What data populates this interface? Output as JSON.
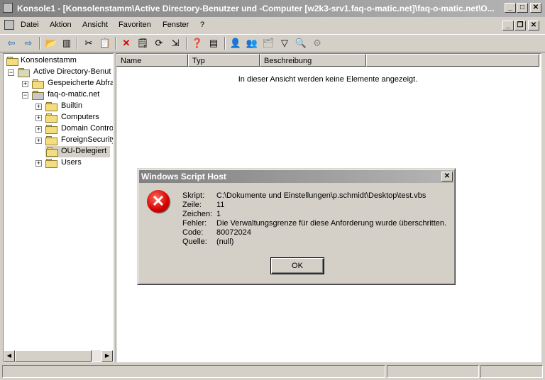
{
  "window": {
    "title": "Konsole1 - [Konsolenstamm\\Active Directory-Benutzer und -Computer [w2k3-srv1.faq-o-matic.net]\\faq-o-matic.net\\O..."
  },
  "menu": {
    "items": [
      "Datei",
      "Aktion",
      "Ansicht",
      "Favoriten",
      "Fenster",
      "?"
    ]
  },
  "tree": {
    "root": "Konsolenstamm",
    "items": [
      {
        "label": "Active Directory-Benut",
        "expander": "−"
      },
      {
        "label": "Gespeicherte Abfra",
        "expander": "+"
      },
      {
        "label": "faq-o-matic.net",
        "expander": "−"
      },
      {
        "label": "Builtin",
        "expander": "+"
      },
      {
        "label": "Computers",
        "expander": "+"
      },
      {
        "label": "Domain Contro",
        "expander": "+"
      },
      {
        "label": "ForeignSecurity",
        "expander": "+"
      },
      {
        "label": "OU-Delegiert",
        "expander": ""
      },
      {
        "label": "Users",
        "expander": "+"
      }
    ]
  },
  "list": {
    "columns": [
      "Name",
      "Typ",
      "Beschreibung"
    ],
    "empty_message": "In dieser Ansicht werden keine Elemente angezeigt."
  },
  "dialog": {
    "title": "Windows Script Host",
    "rows": [
      {
        "label": "Skript:",
        "value": "C:\\Dokumente und Einstellungen\\p.schmidt\\Desktop\\test.vbs"
      },
      {
        "label": "Zeile:",
        "value": "11"
      },
      {
        "label": "Zeichen:",
        "value": "1"
      },
      {
        "label": "Fehler:",
        "value": "Die Verwaltungsgrenze für diese Anforderung wurde überschritten."
      },
      {
        "label": "Code:",
        "value": "80072024"
      },
      {
        "label": "Quelle:",
        "value": "(null)"
      }
    ],
    "ok_label": "OK"
  },
  "colors": {
    "titlebar_inactive": "#808080",
    "face": "#d4d0c8",
    "error_red": "#d40000"
  }
}
